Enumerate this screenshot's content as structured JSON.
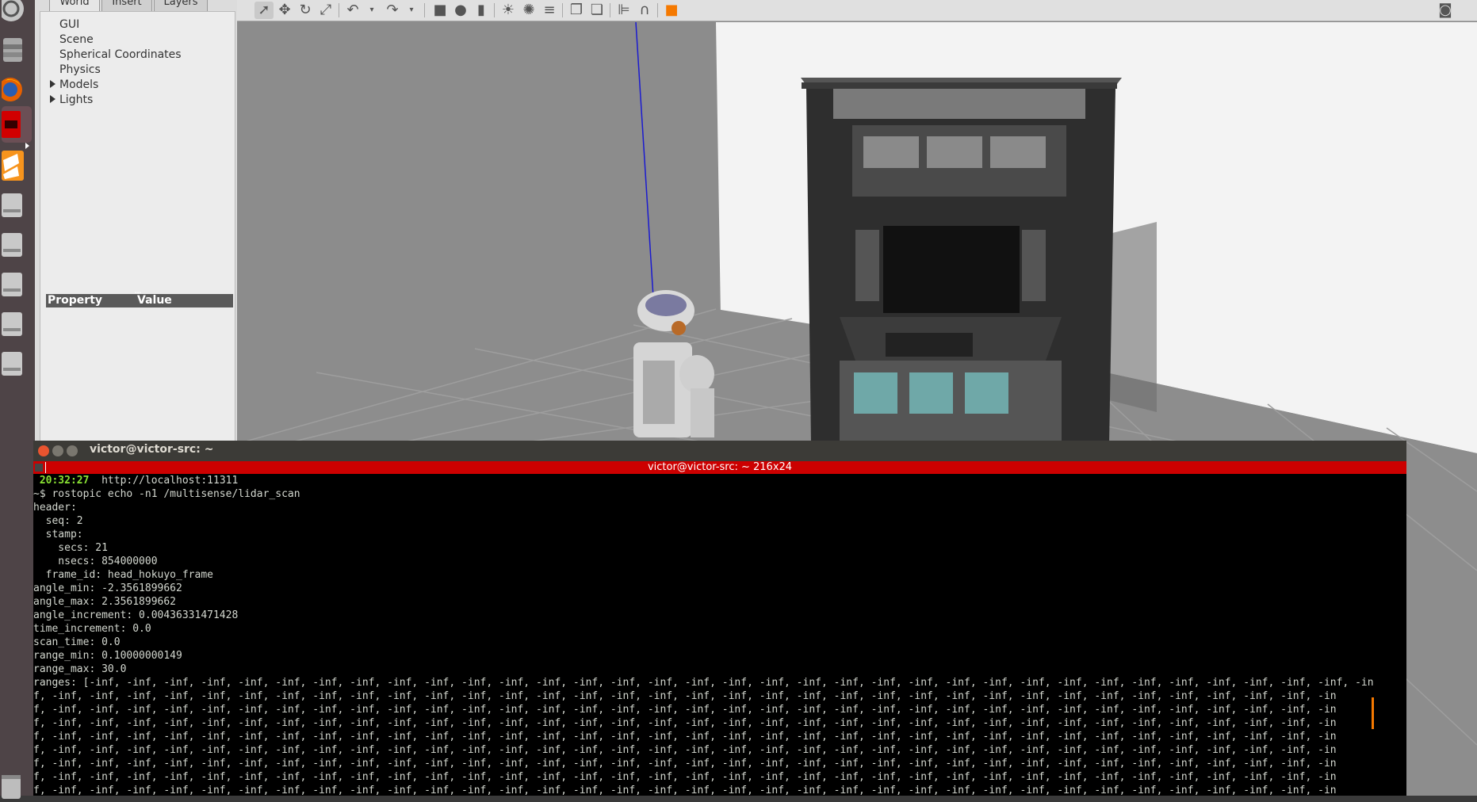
{
  "launcher": {
    "items": [
      {
        "icon": "dash-home-icon"
      },
      {
        "icon": "file-manager-icon"
      },
      {
        "icon": "firefox-icon"
      },
      {
        "icon": "terminal-app-icon"
      },
      {
        "icon": "gazebo-app-icon"
      },
      {
        "icon": "drive-icon"
      },
      {
        "icon": "drive-icon"
      },
      {
        "icon": "drive-icon"
      },
      {
        "icon": "drive-icon"
      },
      {
        "icon": "drive-icon"
      },
      {
        "icon": "trash-icon"
      }
    ]
  },
  "gazebo": {
    "tabs": [
      "World",
      "Insert",
      "Layers"
    ],
    "active_tab": "World",
    "tree": [
      {
        "label": "GUI",
        "expandable": false
      },
      {
        "label": "Scene",
        "expandable": false
      },
      {
        "label": "Spherical Coordinates",
        "expandable": false
      },
      {
        "label": "Physics",
        "expandable": false
      },
      {
        "label": "Models",
        "expandable": true
      },
      {
        "label": "Lights",
        "expandable": true
      }
    ],
    "property_header": {
      "property": "Property",
      "value": "Value"
    },
    "toolbar": [
      {
        "icon": "select-arrow-icon",
        "selected": true
      },
      {
        "icon": "translate-icon"
      },
      {
        "icon": "rotate-icon"
      },
      {
        "icon": "scale-icon"
      },
      {
        "icon": "undo-icon"
      },
      {
        "icon": "undo-history-icon"
      },
      {
        "icon": "redo-icon"
      },
      {
        "icon": "redo-history-icon"
      },
      {
        "icon": "box-shape-icon"
      },
      {
        "icon": "sphere-shape-icon"
      },
      {
        "icon": "cylinder-shape-icon"
      },
      {
        "icon": "point-light-icon"
      },
      {
        "icon": "spot-light-icon"
      },
      {
        "icon": "directional-light-icon"
      },
      {
        "icon": "copy-icon"
      },
      {
        "icon": "paste-icon"
      },
      {
        "icon": "align-icon"
      },
      {
        "icon": "snap-icon"
      },
      {
        "icon": "change-view-icon"
      },
      {
        "icon": "screenshot-icon"
      }
    ]
  },
  "terminal": {
    "window_title": "victor@victor-src: ~",
    "tab_title": "victor@victor-src: ~ 216x24",
    "prompt_time": "20:32:27",
    "prompt_url": "http://localhost:11311",
    "command_line": "~$ rostopic echo -n1 /multisense/lidar_scan",
    "output_lines": [
      "header: ",
      "  seq: 2",
      "  stamp: ",
      "    secs: 21",
      "    nsecs: 854000000",
      "  frame_id: head_hokuyo_frame",
      "angle_min: -2.3561899662",
      "angle_max: 2.3561899662",
      "angle_increment: 0.00436331471428",
      "time_increment: 0.0",
      "scan_time: 0.0",
      "range_min: 0.10000000149",
      "range_max: 30.0"
    ],
    "ranges_lines": [
      "ranges: [-inf, -inf, -inf, -inf, -inf, -inf, -inf, -inf, -inf, -inf, -inf, -inf, -inf, -inf, -inf, -inf, -inf, -inf, -inf, -inf, -inf, -inf, -inf, -inf, -inf, -inf, -inf, -inf, -inf, -inf, -inf, -inf, -inf, -inf, -in",
      "f, -inf, -inf, -inf, -inf, -inf, -inf, -inf, -inf, -inf, -inf, -inf, -inf, -inf, -inf, -inf, -inf, -inf, -inf, -inf, -inf, -inf, -inf, -inf, -inf, -inf, -inf, -inf, -inf, -inf, -inf, -inf, -inf, -inf, -inf, -in",
      "f, -inf, -inf, -inf, -inf, -inf, -inf, -inf, -inf, -inf, -inf, -inf, -inf, -inf, -inf, -inf, -inf, -inf, -inf, -inf, -inf, -inf, -inf, -inf, -inf, -inf, -inf, -inf, -inf, -inf, -inf, -inf, -inf, -inf, -inf, -in",
      "f, -inf, -inf, -inf, -inf, -inf, -inf, -inf, -inf, -inf, -inf, -inf, -inf, -inf, -inf, -inf, -inf, -inf, -inf, -inf, -inf, -inf, -inf, -inf, -inf, -inf, -inf, -inf, -inf, -inf, -inf, -inf, -inf, -inf, -inf, -in",
      "f, -inf, -inf, -inf, -inf, -inf, -inf, -inf, -inf, -inf, -inf, -inf, -inf, -inf, -inf, -inf, -inf, -inf, -inf, -inf, -inf, -inf, -inf, -inf, -inf, -inf, -inf, -inf, -inf, -inf, -inf, -inf, -inf, -inf, -inf, -in",
      "f, -inf, -inf, -inf, -inf, -inf, -inf, -inf, -inf, -inf, -inf, -inf, -inf, -inf, -inf, -inf, -inf, -inf, -inf, -inf, -inf, -inf, -inf, -inf, -inf, -inf, -inf, -inf, -inf, -inf, -inf, -inf, -inf, -inf, -inf, -in",
      "f, -inf, -inf, -inf, -inf, -inf, -inf, -inf, -inf, -inf, -inf, -inf, -inf, -inf, -inf, -inf, -inf, -inf, -inf, -inf, -inf, -inf, -inf, -inf, -inf, -inf, -inf, -inf, -inf, -inf, -inf, -inf, -inf, -inf, -inf, -in",
      "f, -inf, -inf, -inf, -inf, -inf, -inf, -inf, -inf, -inf, -inf, -inf, -inf, -inf, -inf, -inf, -inf, -inf, -inf, -inf, -inf, -inf, -inf, -inf, -inf, -inf, -inf, -inf, -inf, -inf, -inf, -inf, -inf, -inf, -inf, -in",
      "f, -inf, -inf, -inf, -inf, -inf, -inf, -inf, -inf, -inf, -inf, -inf, -inf, -inf, -inf, -inf, -inf, -inf, -inf, -inf, -inf, -inf, -inf, -inf, -inf, -inf, -inf, -inf, -inf, -inf, -inf, -inf, -inf, -inf, -inf, -in"
    ]
  },
  "colors": {
    "terminal_red_bar": "#cc0000",
    "prompt_green": "#8ae234",
    "close_button": "#e9542f",
    "launcher_bg": "#4e4447"
  }
}
